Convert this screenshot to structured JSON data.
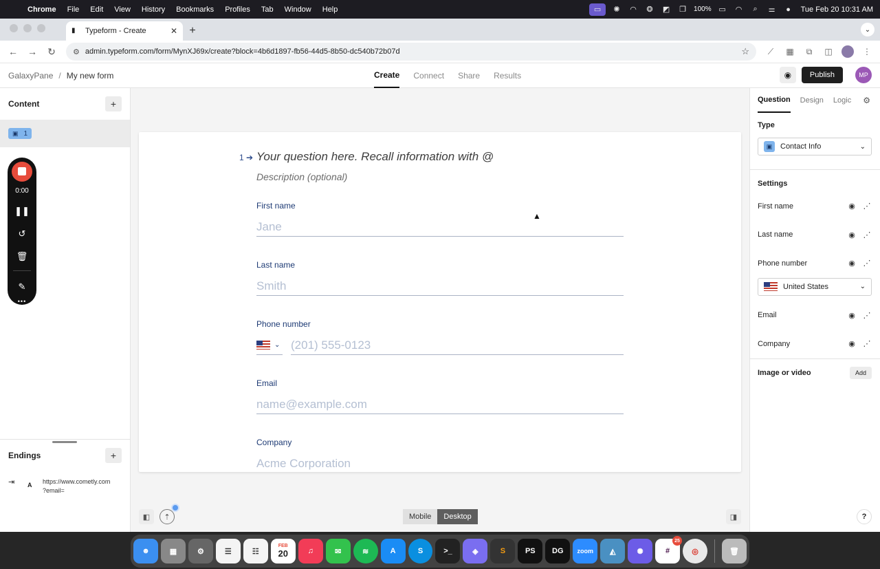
{
  "menubar": {
    "app": "Chrome",
    "items": [
      "File",
      "Edit",
      "View",
      "History",
      "Bookmarks",
      "Profiles",
      "Tab",
      "Window",
      "Help"
    ],
    "battery": "100%",
    "clock": "Tue Feb 20  10:31 AM"
  },
  "browser": {
    "tab_title": "Typeform - Create",
    "url": "admin.typeform.com/form/MynXJ69x/create?block=4b6d1897-fb56-44d5-8b50-dc540b72b07d"
  },
  "header": {
    "workspace": "GalaxyPane",
    "separator": "/",
    "form_name": "My new form",
    "tabs": [
      {
        "label": "Create",
        "active": true
      },
      {
        "label": "Connect",
        "active": false
      },
      {
        "label": "Share",
        "active": false
      },
      {
        "label": "Results",
        "active": false
      }
    ],
    "publish_label": "Publish",
    "avatar_initials": "MP"
  },
  "left_panel": {
    "content_title": "Content",
    "question_number": "1",
    "endings_title": "Endings",
    "ending_letter": "A",
    "ending_url_line1": "https://www.cometly.com",
    "ending_url_line2": "?email="
  },
  "recorder": {
    "time": "0:00"
  },
  "form": {
    "question_number": "1",
    "question_placeholder": "Your question here. Recall information with @",
    "description_placeholder": "Description (optional)",
    "fields": {
      "first_name": {
        "label": "First name",
        "placeholder": "Jane"
      },
      "last_name": {
        "label": "Last name",
        "placeholder": "Smith"
      },
      "phone": {
        "label": "Phone number",
        "placeholder": "(201) 555-0123"
      },
      "email": {
        "label": "Email",
        "placeholder": "name@example.com"
      },
      "company": {
        "label": "Company",
        "placeholder": "Acme Corporation"
      }
    }
  },
  "view_toggle": {
    "mobile": "Mobile",
    "desktop": "Desktop",
    "selected": "Desktop"
  },
  "right_panel": {
    "tabs": [
      {
        "label": "Question",
        "active": true
      },
      {
        "label": "Design",
        "active": false
      },
      {
        "label": "Logic",
        "active": false
      }
    ],
    "type_title": "Type",
    "type_value": "Contact Info",
    "settings_title": "Settings",
    "settings": {
      "first_name": "First name",
      "last_name": "Last name",
      "phone_number": "Phone number",
      "email": "Email",
      "company": "Company"
    },
    "country_value": "United States",
    "image_video_label": "Image or video",
    "add_label": "Add",
    "help_label": "?"
  },
  "dock": {
    "calendar_month": "FEB",
    "calendar_day": "20",
    "slack_badge": "25",
    "zoom_label": "zoom",
    "phpstorm_label": "PS",
    "datagrip_label": "DG"
  },
  "colors": {
    "accent_label": "#1d3a74",
    "question_badge": "#7fb4ec",
    "publish_bg": "#1f1f1f",
    "recorder_stop": "#e74c3c"
  }
}
